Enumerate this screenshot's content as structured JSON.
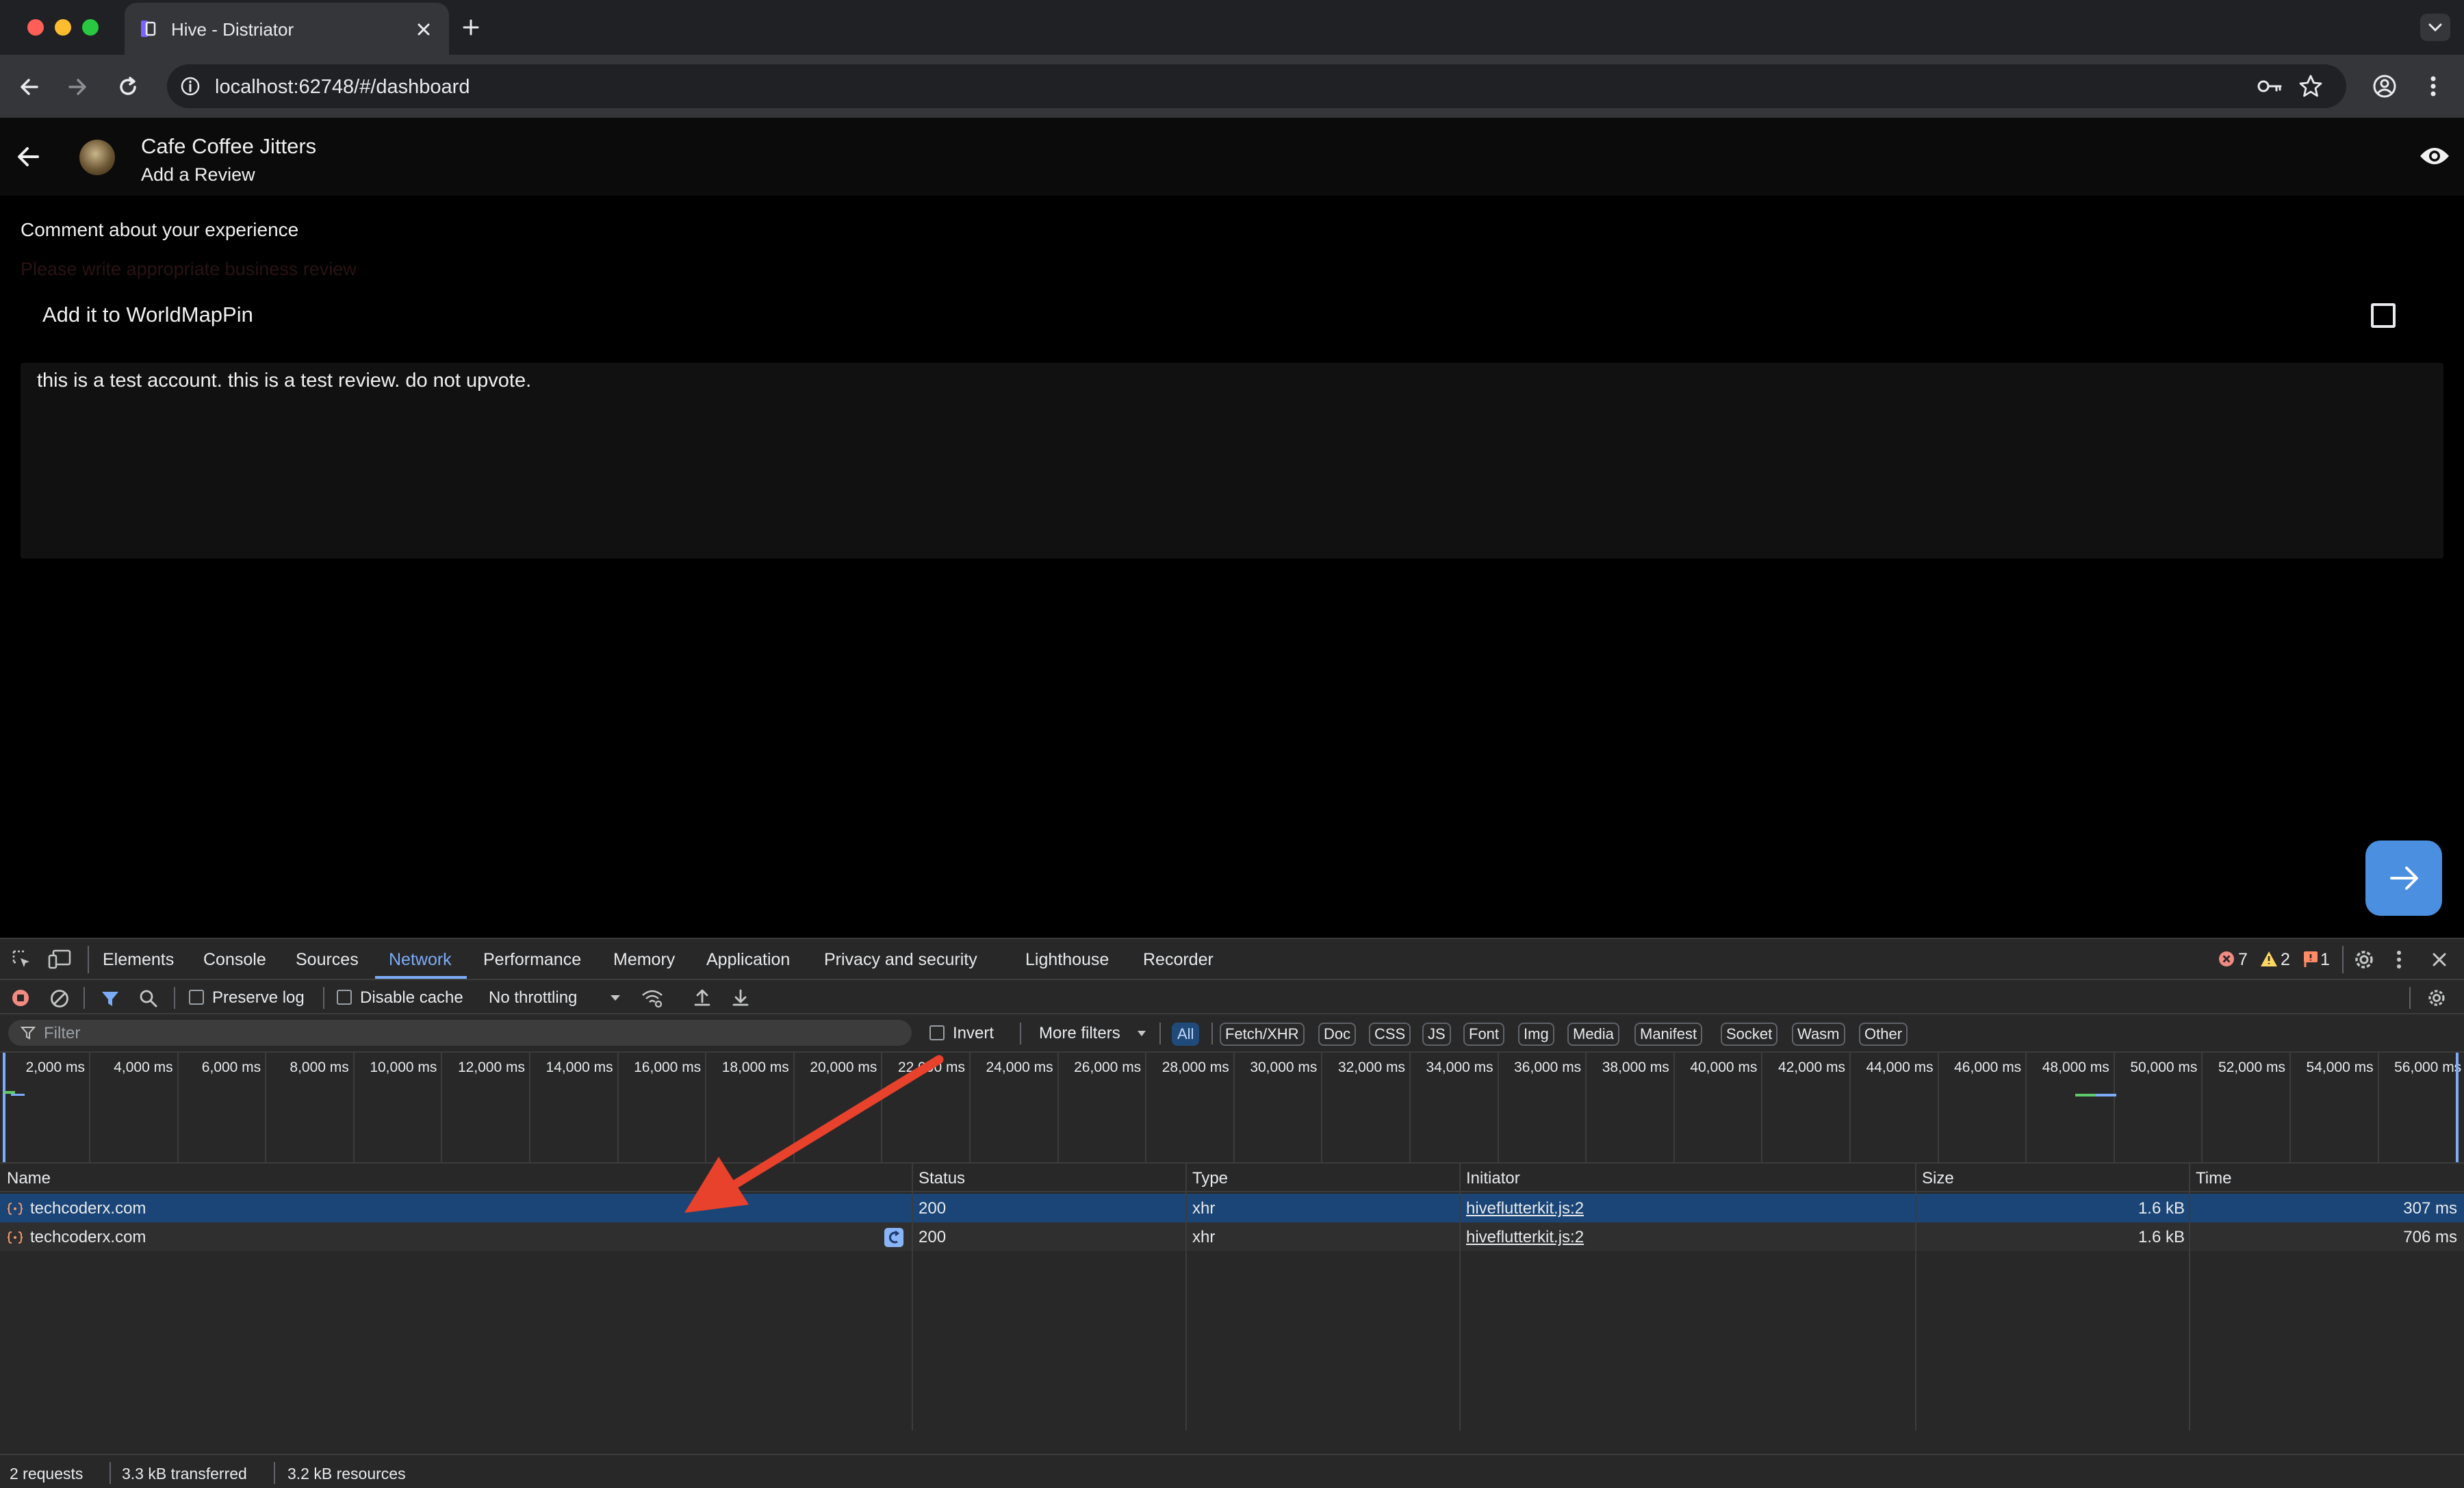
{
  "browser": {
    "tab_title": "Hive - Distriator",
    "url": "localhost:62748/#/dashboard"
  },
  "app": {
    "business_name": "Cafe Coffee Jitters",
    "subtitle": "Add a Review",
    "comment_label": "Comment about your experience",
    "hint_text": "Please write appropriate business review",
    "worldmappin_label": "Add it to WorldMapPin",
    "worldmappin_checked": false,
    "review_text": "this is a test account. this is a test review. do not upvote.",
    "accent_color": "#4a8fe0"
  },
  "devtools": {
    "tabs": [
      "Elements",
      "Console",
      "Sources",
      "Network",
      "Performance",
      "Memory",
      "Application",
      "Privacy and security",
      "Lighthouse",
      "Recorder"
    ],
    "active_tab": "Network",
    "issues": {
      "errors": "7",
      "warnings": "2",
      "info": "1"
    },
    "controls": {
      "preserve_log": "Preserve log",
      "disable_cache": "Disable cache",
      "throttling": "No throttling"
    },
    "filter": {
      "placeholder": "Filter",
      "invert": "Invert",
      "more_filters": "More filters",
      "types": [
        "All",
        "Fetch/XHR",
        "Doc",
        "CSS",
        "JS",
        "Font",
        "Img",
        "Media",
        "Manifest",
        "Socket",
        "Wasm",
        "Other"
      ],
      "active_type": "All"
    },
    "timeline_ticks": [
      "2,000 ms",
      "4,000 ms",
      "6,000 ms",
      "8,000 ms",
      "10,000 ms",
      "12,000 ms",
      "14,000 ms",
      "16,000 ms",
      "18,000 ms",
      "20,000 ms",
      "22,000 ms",
      "24,000 ms",
      "26,000 ms",
      "28,000 ms",
      "30,000 ms",
      "32,000 ms",
      "34,000 ms",
      "36,000 ms",
      "38,000 ms",
      "40,000 ms",
      "42,000 ms",
      "44,000 ms",
      "46,000 ms",
      "48,000 ms",
      "50,000 ms",
      "52,000 ms",
      "54,000 ms",
      "56,000 ms"
    ],
    "columns": [
      "Name",
      "Status",
      "Type",
      "Initiator",
      "Size",
      "Time"
    ],
    "rows": [
      {
        "name": "techcoderx.com",
        "status": "200",
        "type": "xhr",
        "initiator": "hiveflutterkit.js:2",
        "size": "1.6 kB",
        "time": "307 ms"
      },
      {
        "name": "techcoderx.com",
        "status": "200",
        "type": "xhr",
        "initiator": "hiveflutterkit.js:2",
        "size": "1.6 kB",
        "time": "706 ms"
      }
    ],
    "status_bar": {
      "requests": "2 requests",
      "transferred": "3.3 kB transferred",
      "resources": "3.2 kB resources"
    }
  }
}
